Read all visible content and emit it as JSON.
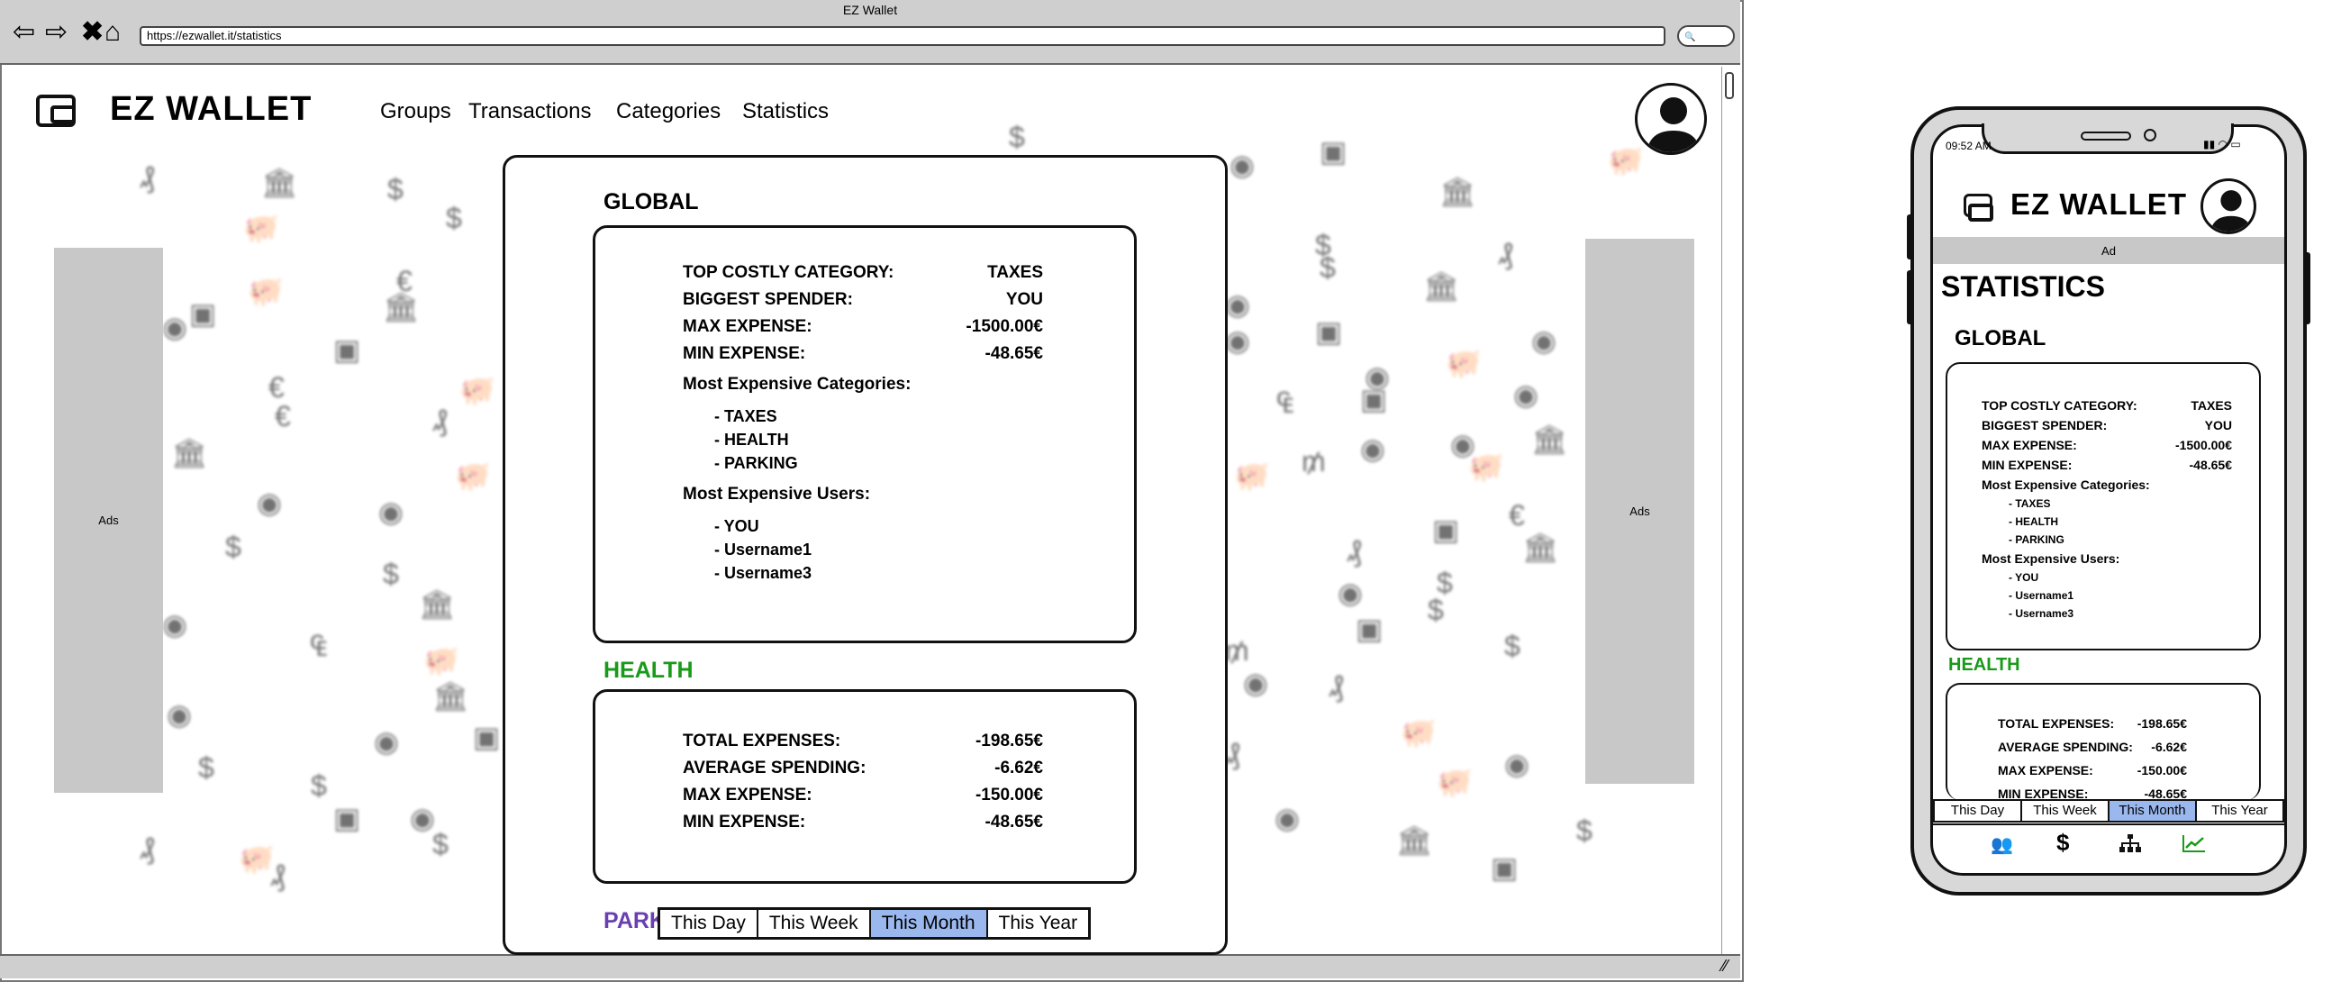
{
  "browser": {
    "window_title": "EZ Wallet",
    "url": "https://ezwallet.it/statistics",
    "search_glyph": "🔍"
  },
  "app": {
    "logo_text": "EZ WALLET",
    "nav": [
      "Groups",
      "Transactions",
      "Categories",
      "Statistics"
    ],
    "ad_label": "Ads"
  },
  "global": {
    "title": "GLOBAL",
    "stats": [
      {
        "label": "TOP COSTLY CATEGORY:",
        "value": "TAXES"
      },
      {
        "label": "BIGGEST SPENDER:",
        "value": "YOU"
      },
      {
        "label": "MAX EXPENSE:",
        "value": "-1500.00€"
      },
      {
        "label": "MIN EXPENSE:",
        "value": "-48.65€"
      }
    ],
    "categories_title": "Most Expensive Categories:",
    "categories": [
      "- TAXES",
      "- HEALTH",
      "- PARKING"
    ],
    "users_title": "Most Expensive Users:",
    "users": [
      "- YOU",
      "- Username1",
      "- Username3"
    ]
  },
  "health": {
    "title": "HEALTH",
    "color": "#1a9a1a",
    "stats": [
      {
        "label": "TOTAL EXPENSES:",
        "value": "-198.65€"
      },
      {
        "label": "AVERAGE SPENDING:",
        "value": "-6.62€"
      },
      {
        "label": "MAX EXPENSE:",
        "value": "-150.00€"
      },
      {
        "label": "MIN EXPENSE:",
        "value": "-48.65€"
      }
    ]
  },
  "parking": {
    "title_partial": "PARK",
    "color": "#6a3fb0"
  },
  "period_tabs": {
    "items": [
      "This Day",
      "This Week",
      "This Month",
      "This Year"
    ],
    "active": "This Month",
    "active_color": "#9ab8ee"
  },
  "mobile": {
    "time": "09:52 AM",
    "ad_label": "Ad",
    "page_title": "STATISTICS",
    "bottom_nav_icons": [
      "group-icon",
      "dollar-icon",
      "hierarchy-icon",
      "chart-line-icon"
    ],
    "active_nav_color": "#1a9a1a"
  }
}
